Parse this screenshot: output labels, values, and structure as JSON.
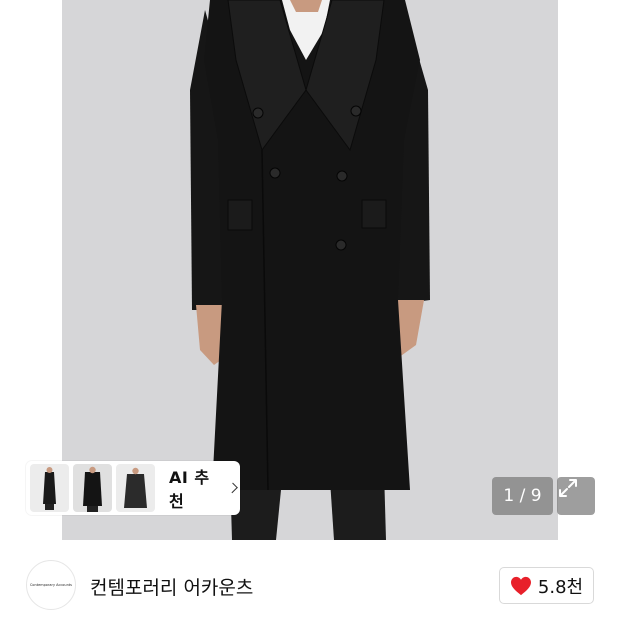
{
  "gallery": {
    "ai_recommend_label": "AI 추천",
    "page_indicator": "1 / 9",
    "thumbnails": [
      "thumbnail-1",
      "thumbnail-2",
      "thumbnail-3"
    ],
    "icons": {
      "expand": "expand-arrows-icon",
      "chevron": "chevron-right-icon"
    }
  },
  "brand": {
    "logo_text": "Contemporary Accounts",
    "name": "컨템포러리 어카운츠",
    "likes": "5.8천",
    "heart_color": "#e8202a",
    "heart_icon": "heart-icon"
  },
  "colors": {
    "background": "#ffffff",
    "backdrop": "#d6d6d8",
    "coat": "#151515",
    "overlay": "#787878"
  }
}
